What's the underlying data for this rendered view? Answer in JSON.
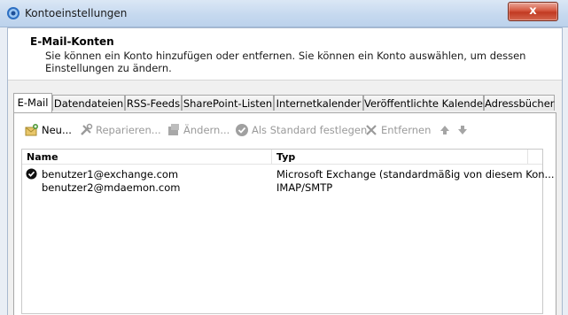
{
  "window": {
    "title": "Kontoeinstellungen",
    "close_label": "x"
  },
  "header": {
    "title": "E-Mail-Konten",
    "description": "Sie können ein Konto hinzufügen oder entfernen. Sie können ein Konto auswählen, um dessen Einstellungen zu ändern."
  },
  "tabs": [
    "E-Mail",
    "Datendateien",
    "RSS-Feeds",
    "SharePoint-Listen",
    "Internetkalender",
    "Veröffentlichte Kalender",
    "Adressbücher"
  ],
  "toolbar": {
    "new_label": "Neu...",
    "repair_label": "Reparieren...",
    "change_label": "Ändern...",
    "default_label": "Als Standard festlegen",
    "remove_label": "Entfernen"
  },
  "list": {
    "columns": {
      "name": "Name",
      "type": "Typ"
    },
    "rows": [
      {
        "name": "benutzer1@exchange.com",
        "type": "Microsoft Exchange (standardmäßig von diesem Kon...",
        "default": true
      },
      {
        "name": "benutzer2@mdaemon.com",
        "type": "IMAP/SMTP",
        "default": false
      }
    ]
  }
}
